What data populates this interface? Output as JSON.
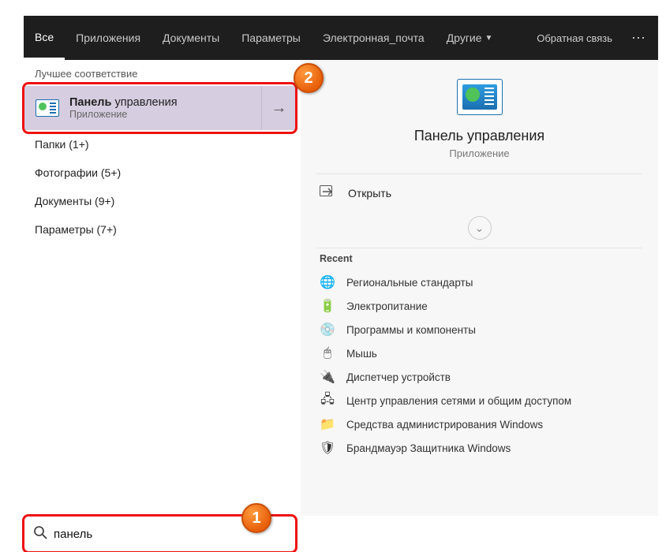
{
  "tabs": {
    "items": [
      "Все",
      "Приложения",
      "Документы",
      "Параметры",
      "Электронная_почта",
      "Другие"
    ],
    "active_index": 0,
    "feedback": "Обратная связь"
  },
  "left": {
    "best_match_header": "Лучшее соответствие",
    "selected": {
      "title_bold": "Панель",
      "title_rest": " управления",
      "subtitle": "Приложение"
    },
    "categories": [
      "Папки (1+)",
      "Фотографии (5+)",
      "Документы (9+)",
      "Параметры (7+)"
    ]
  },
  "right": {
    "title": "Панель управления",
    "subtitle": "Приложение",
    "open_label": "Открыть",
    "recent_header": "Recent",
    "recent": [
      {
        "icon": "🌐",
        "label": "Региональные стандарты"
      },
      {
        "icon": "🔋",
        "label": "Электропитание"
      },
      {
        "icon": "💿",
        "label": "Программы и компоненты"
      },
      {
        "icon": "🖱",
        "label": "Мышь"
      },
      {
        "icon": "🔌",
        "label": "Диспетчер устройств"
      },
      {
        "icon": "🖧",
        "label": "Центр управления сетями и общим доступом"
      },
      {
        "icon": "📁",
        "label": "Средства администрирования Windows"
      },
      {
        "icon": "🛡",
        "label": "Брандмауэр Защитника Windows"
      }
    ]
  },
  "search": {
    "value": "панель"
  },
  "annotations": {
    "badge1": "1",
    "badge2": "2"
  }
}
